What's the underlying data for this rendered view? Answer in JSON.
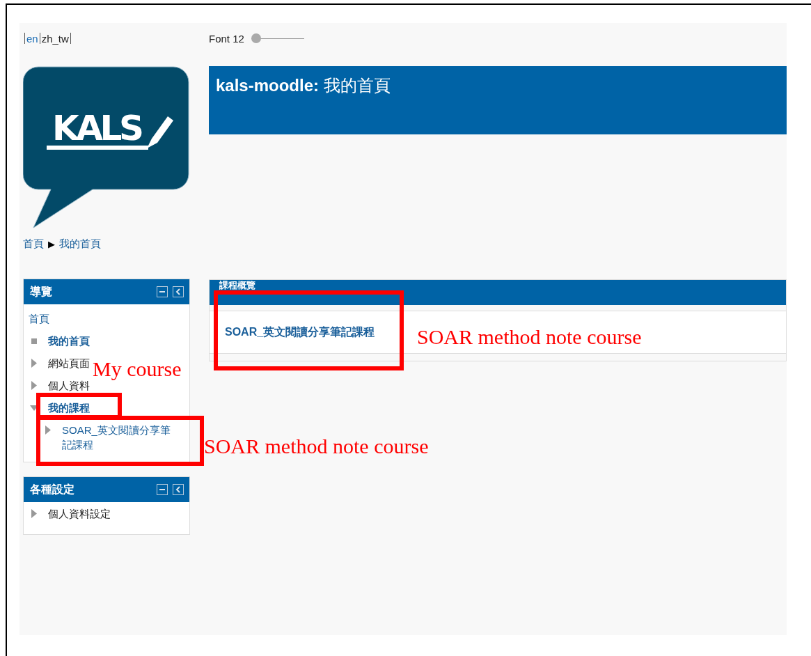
{
  "languages": [
    {
      "label": "en",
      "selected": false
    },
    {
      "label": "zh_tw",
      "selected": true
    }
  ],
  "font": {
    "label": "Font 12",
    "level": 0
  },
  "logo": {
    "text": "KALS"
  },
  "header": {
    "title": "**kals-moodle:** 我的首頁"
  },
  "breadcrumb": {
    "items": [
      "首頁",
      "我的首頁"
    ],
    "separator": "▶"
  },
  "navigation": {
    "title": "導覽",
    "items": [
      {
        "label": "首頁",
        "kind": "root",
        "link": true,
        "bold": false,
        "children": [
          {
            "label": "我的首頁",
            "kind": "leaf",
            "link": true,
            "bold": true
          },
          {
            "label": "網站頁面",
            "kind": "branch",
            "expanded": false,
            "link": false,
            "bold": false
          },
          {
            "label": "個人資料",
            "kind": "branch",
            "expanded": false,
            "link": false,
            "bold": false
          },
          {
            "label": "我的課程",
            "kind": "branch",
            "expanded": true,
            "link": true,
            "bold": true,
            "children": [
              {
                "label": "SOAR_英文閱讀分享筆記課程",
                "kind": "branch",
                "expanded": false,
                "link": true,
                "bold": false
              }
            ]
          }
        ]
      }
    ]
  },
  "settings": {
    "title": "各種設定",
    "items": [
      {
        "label": "個人資料設定",
        "kind": "branch",
        "expanded": false,
        "link": false,
        "bold": false
      }
    ]
  },
  "course_overview": {
    "title": "課程概覽",
    "courses": [
      "SOAR_英文閱讀分享筆記課程"
    ]
  },
  "annotations": [
    {
      "kind": "box"
    },
    {
      "kind": "label",
      "text": "SOAR method note course"
    },
    {
      "kind": "label",
      "text": "My course"
    },
    {
      "kind": "box"
    },
    {
      "kind": "box"
    },
    {
      "kind": "label",
      "text": "SOAR method note course"
    }
  ]
}
